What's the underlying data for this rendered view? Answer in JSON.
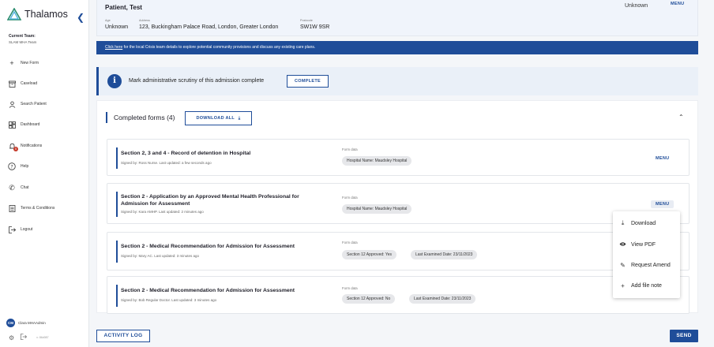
{
  "app": {
    "name": "Thalamos"
  },
  "sidebar": {
    "team_label": "Current Team:",
    "team_name": "SLAM MHA Team",
    "items": [
      {
        "label": "New Form",
        "icon": "plus-icon"
      },
      {
        "label": "Caseload",
        "icon": "archive-icon"
      },
      {
        "label": "Search Patient",
        "icon": "person-icon"
      },
      {
        "label": "Dashboard",
        "icon": "dashboard-icon"
      },
      {
        "label": "Notifications",
        "icon": "bell-icon",
        "badge": "0"
      },
      {
        "label": "Help",
        "icon": "help-icon"
      },
      {
        "label": "Chat",
        "icon": "phone-icon"
      },
      {
        "label": "Terms & Conditions",
        "icon": "document-icon"
      },
      {
        "label": "Logout",
        "icon": "logout-icon"
      }
    ],
    "user": {
      "initials": "CM",
      "name": "Clara MHAAdmin"
    },
    "version": "v: 86d087"
  },
  "patient": {
    "name": "Patient, Test",
    "age_label": "Age",
    "age_value": "Unknown",
    "address_label": "Address",
    "address_value": "123, Buckingham Palace Road, London, Greater London",
    "postcode_label": "Postcode",
    "postcode_value": "SW1W 9SR",
    "right_value": "Unknown",
    "menu_label": "MENU"
  },
  "banner": {
    "link_text": "Click here",
    "text": " for the local Crisis team details to explore potential community provisions and discuss any existing care plans."
  },
  "scrutiny": {
    "text": "Mark administrative scrutiny of this admission complete",
    "button": "COMPLETE"
  },
  "forms": {
    "title": "Completed forms (4)",
    "download_all": "DOWNLOAD ALL",
    "form_data_label": "Form data",
    "menu_label": "MENU",
    "items": [
      {
        "title": "Section 2, 3 and 4 - Record of detention in Hospital",
        "signed": "Signed by: Ross Nurse. Last updated: a few seconds ago",
        "chips": [
          "Hospital Name: Maudsley Hospital"
        ]
      },
      {
        "title": "Section 2 - Application by an Approved Mental Health Professional for Admission for Assessment",
        "signed": "Signed by: Kara AMHP. Last updated: 2 minutes ago",
        "chips": [
          "Hospital Name: Maudsley Hospital"
        ]
      },
      {
        "title": "Section 2 - Medical Recommendation for Admission for Assessment",
        "signed": "Signed by: Mary AC. Last updated: 3 minutes ago",
        "chips": [
          "Section 12 Approved: Yes",
          "Last Examined Date: 23/11/2023"
        ]
      },
      {
        "title": "Section 2 - Medical Recommendation for Admission for Assessment",
        "signed": "Signed by: Bob Regular Doctor. Last updated: 3 minutes ago",
        "chips": [
          "Section 12 Approved: No",
          "Last Examined Date: 23/11/2023"
        ]
      }
    ]
  },
  "dropdown": {
    "items": [
      {
        "label": "Download",
        "icon": "download-icon"
      },
      {
        "label": "View PDF",
        "icon": "eye-icon"
      },
      {
        "label": "Request Amend",
        "icon": "pencil-icon"
      },
      {
        "label": "Add file note",
        "icon": "plus-icon"
      }
    ]
  },
  "actions": {
    "activity_log": "ACTIVITY LOG",
    "send": "SEND"
  },
  "colors": {
    "primary": "#1f4d99",
    "badge": "#c53a2b"
  }
}
